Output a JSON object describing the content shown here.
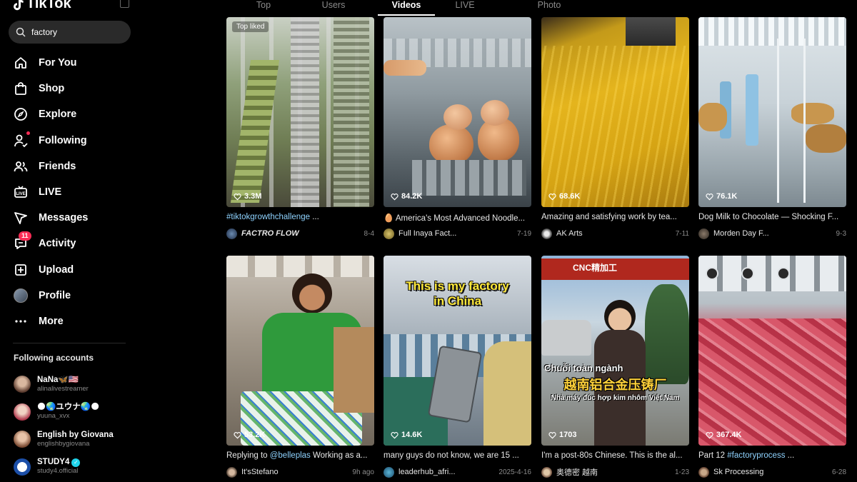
{
  "brand": {
    "name": "TikTok"
  },
  "search": {
    "value": "factory"
  },
  "nav": [
    {
      "label": "For You",
      "icon": "home-icon"
    },
    {
      "label": "Shop",
      "icon": "shop-bag-icon"
    },
    {
      "label": "Explore",
      "icon": "compass-icon"
    },
    {
      "label": "Following",
      "icon": "following-user-icon"
    },
    {
      "label": "Friends",
      "icon": "friends-icon"
    },
    {
      "label": "LIVE",
      "icon": "live-tv-icon"
    },
    {
      "label": "Messages",
      "icon": "paper-plane-icon"
    },
    {
      "label": "Activity",
      "icon": "activity-message-icon",
      "badge": "11"
    },
    {
      "label": "Upload",
      "icon": "upload-plus-icon"
    },
    {
      "label": "Profile",
      "icon": "profile-avatar"
    },
    {
      "label": "More",
      "icon": "more-dots-icon"
    }
  ],
  "following_accounts": {
    "title": "Following accounts",
    "items": [
      {
        "name": "NaNa🦋🇺🇸",
        "handle": "alinalivestreamer"
      },
      {
        "name": "🌑🌏ユウナ🌏🌑",
        "handle": "yuuna_xvx"
      },
      {
        "name": "English by Giovana",
        "handle": "englishbygiovana"
      },
      {
        "name": "STUDY4",
        "handle": "study4.official",
        "verified": true
      }
    ]
  },
  "tabs": [
    {
      "label": "Top",
      "active": false
    },
    {
      "label": "Users",
      "active": false
    },
    {
      "label": "Videos",
      "active": true
    },
    {
      "label": "LIVE",
      "active": false
    },
    {
      "label": "Photo",
      "active": false
    }
  ],
  "videos": [
    {
      "top_label": "Top liked",
      "views": "3.3M",
      "desc_tag": "#tiktokgrowthchallenge",
      "desc": " ...",
      "user": "FACTRO FLOW",
      "date": "8-4",
      "italic_user": true
    },
    {
      "views": "84.2K",
      "desc_prefix": "🥚 ",
      "desc": "America's Most Advanced Noodle...",
      "user": "Full Inaya Fact...",
      "date": "7-19"
    },
    {
      "views": "68.6K",
      "desc": "Amazing and satisfying work by tea...",
      "user": "AK Arts",
      "date": "7-11"
    },
    {
      "views": "76.1K",
      "desc": "Dog Milk to Chocolate — Shocking F...",
      "user": "Morden Day F...",
      "date": "9-3"
    },
    {
      "views": "53.2K",
      "desc": "Replying to ",
      "desc_tag_after": "@belleplas",
      "desc_suffix": " Working as a...",
      "user": "It'sStefano",
      "date": "9h ago"
    },
    {
      "views": "14.6K",
      "desc": "many guys do not know,  we are 15 ...",
      "user": "leaderhub_afri...",
      "date": "2025-4-16",
      "overlay": "This is my factory in China"
    },
    {
      "views": "1703",
      "desc": "I'm a post-80s Chinese. This is the al...",
      "user": "奥德密 越南",
      "date": "1-23",
      "overlay_vn": "Chuỗi toàn ngành",
      "overlay_cn": "越南铝合金压铸厂",
      "overlay_vn2": "Nhà máy đúc hợp kim nhôm Việt Nam",
      "sign": "CNC精加工"
    },
    {
      "views": "367.4K",
      "desc": "Part 12 ",
      "desc_tag_after": "#factoryprocess",
      "desc_suffix": " ...",
      "user": "Sk Processing",
      "date": "6-28"
    }
  ],
  "colors": {
    "accent": "#fe2c55",
    "link": "#8fd3ff",
    "verified": "#20d5ec"
  }
}
